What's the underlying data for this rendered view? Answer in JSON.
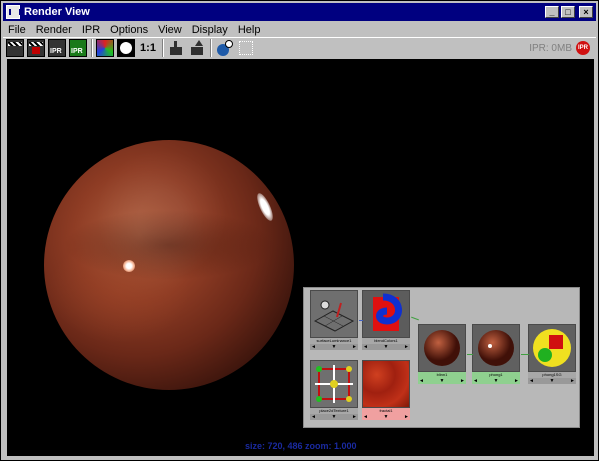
{
  "window": {
    "title": "Render View"
  },
  "menu": [
    "File",
    "Render",
    "IPR",
    "Options",
    "View",
    "Display",
    "Help"
  ],
  "toolbar": {
    "one_to_one_label": "1:1",
    "ipr_label": "IPR",
    "ipr_status": "IPR: 0MB",
    "ipr_badge": "IPR"
  },
  "nodes": {
    "surface": "surfaceLuminance1",
    "blend": "blendColors1",
    "place": "place2dTexture1",
    "fractal": "fractal1",
    "blinn": "blinn1",
    "phong": "phong1",
    "phongsg": "phong1SG"
  },
  "status_line": "size: 720, 486 zoom: 1.000",
  "colors": {
    "title_bar": "#000080",
    "status_text": "#1a2aa0",
    "ipr_badge": "#d01010"
  }
}
